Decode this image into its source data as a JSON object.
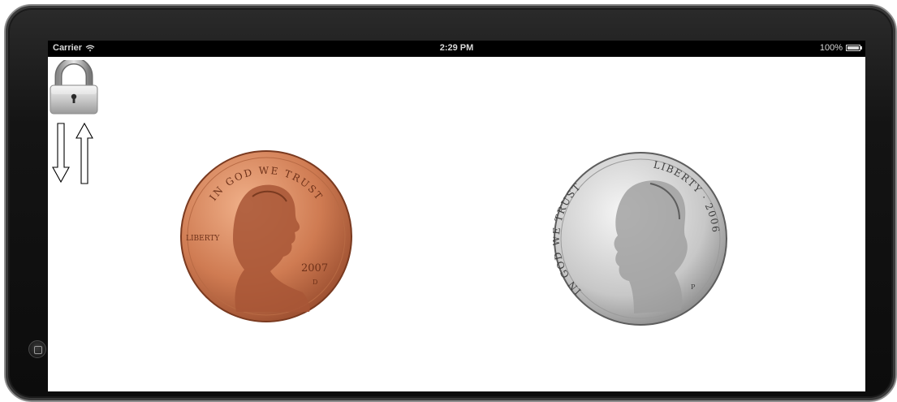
{
  "status_bar": {
    "carrier": "Carrier",
    "time": "2:29 PM",
    "battery_text": "100%",
    "battery_level": 1.0
  },
  "lock_button": {
    "icon": "padlock-icon",
    "state": "locked"
  },
  "rotation_arrows": {
    "icon": "up-down-arrows-icon"
  },
  "coins": {
    "penny": {
      "motto": "IN GOD WE TRUST",
      "liberty": "LIBERTY",
      "year": "2007",
      "mint_mark": "D"
    },
    "nickel": {
      "motto": "IN GOD WE TRUST",
      "liberty": "LIBERTY",
      "year": "2006",
      "mint_mark": "P"
    }
  },
  "colors": {
    "penny_light": "#f0b089",
    "penny_mid": "#cf7b52",
    "penny_dark": "#8e4327",
    "nickel_light": "#f6f6f6",
    "nickel_mid": "#c7c7c7",
    "nickel_dark": "#6f6f6f"
  }
}
